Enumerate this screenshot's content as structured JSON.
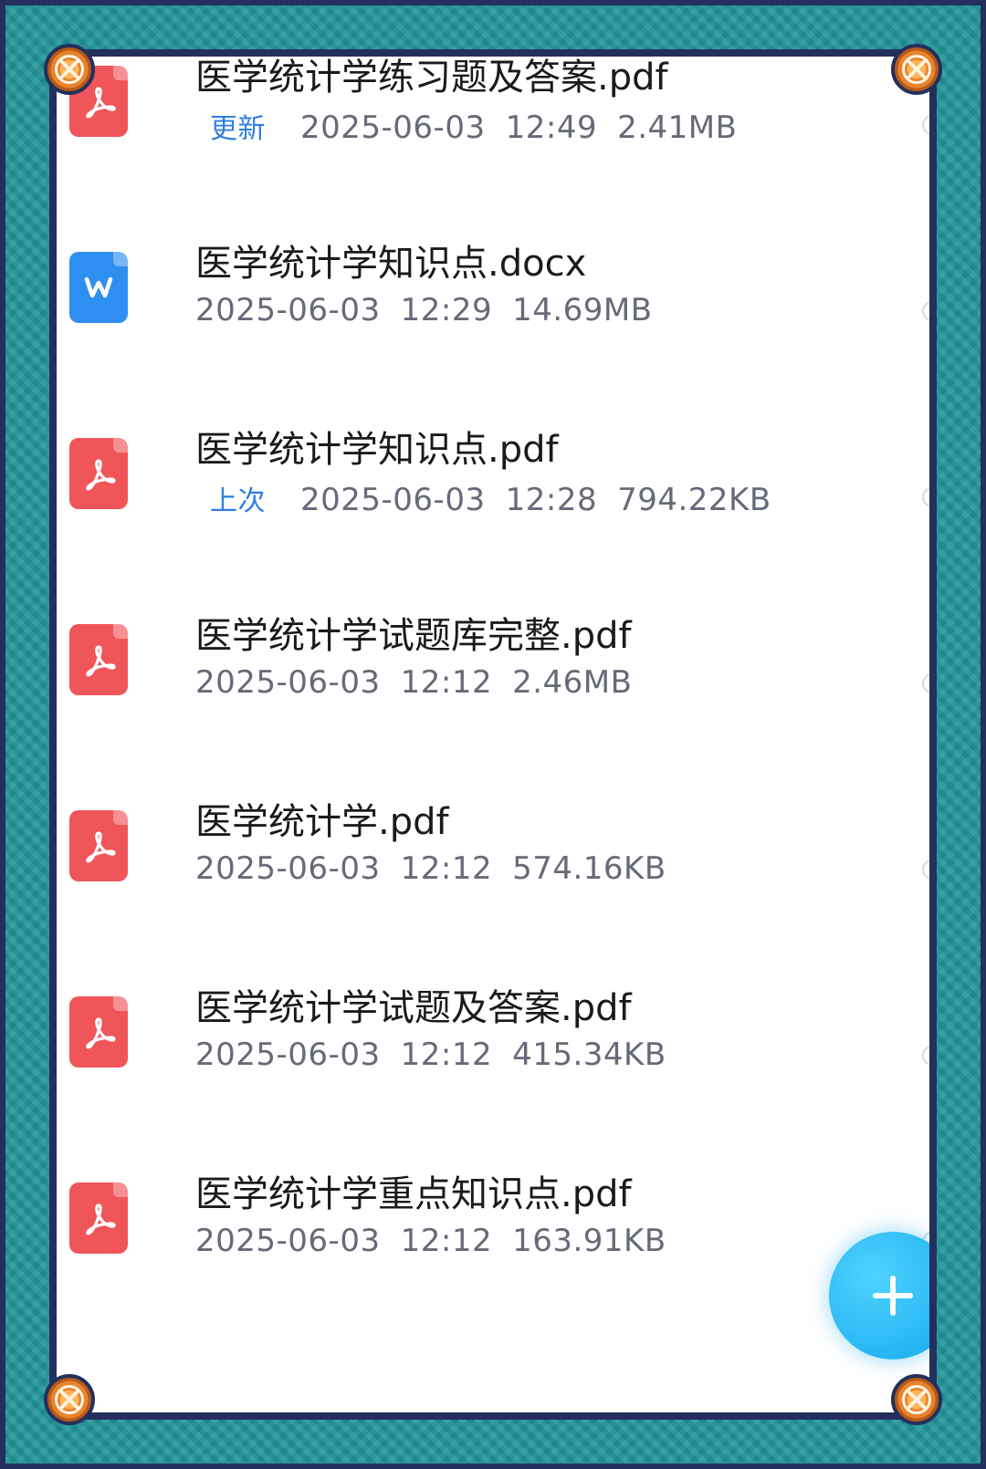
{
  "files": [
    {
      "name": "医学统计学练习题及答案.pdf",
      "type": "pdf",
      "tag": "更新",
      "date": "2025-06-03",
      "time": "12:49",
      "size": "2.41MB",
      "icon": "pdf-file-icon"
    },
    {
      "name": "医学统计学知识点.docx",
      "type": "docx",
      "tag": "",
      "date": "2025-06-03",
      "time": "12:29",
      "size": "14.69MB",
      "icon": "word-file-icon"
    },
    {
      "name": "医学统计学知识点.pdf",
      "type": "pdf",
      "tag": "上次",
      "date": "2025-06-03",
      "time": "12:28",
      "size": "794.22KB",
      "icon": "pdf-file-icon"
    },
    {
      "name": "医学统计学试题库完整.pdf",
      "type": "pdf",
      "tag": "",
      "date": "2025-06-03",
      "time": "12:12",
      "size": "2.46MB",
      "icon": "pdf-file-icon"
    },
    {
      "name": "医学统计学.pdf",
      "type": "pdf",
      "tag": "",
      "date": "2025-06-03",
      "time": "12:12",
      "size": "574.16KB",
      "icon": "pdf-file-icon"
    },
    {
      "name": "医学统计学试题及答案.pdf",
      "type": "pdf",
      "tag": "",
      "date": "2025-06-03",
      "time": "12:12",
      "size": "415.34KB",
      "icon": "pdf-file-icon"
    },
    {
      "name": "医学统计学重点知识点.pdf",
      "type": "pdf",
      "tag": "",
      "date": "2025-06-03",
      "time": "12:12",
      "size": "163.91KB",
      "icon": "pdf-file-icon"
    }
  ],
  "fab": {
    "icon": "plus-icon"
  },
  "colors": {
    "pdf": "#f0555a",
    "docx": "#2f8ff0",
    "tag": "#2d7fe0",
    "frame": "#21959a",
    "frame_border": "#23305e",
    "fab": "#14a9ee"
  }
}
